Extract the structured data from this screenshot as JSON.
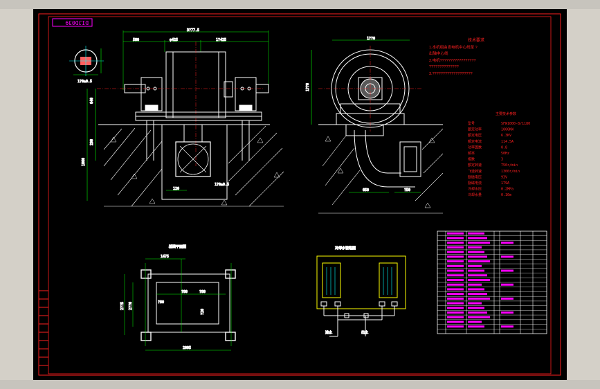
{
  "title_stamp": "DIJD039",
  "dims": {
    "top_total": "3?77.5",
    "d1": "580",
    "d2": "φ425",
    "d3": "1?425",
    "left_v1": "640",
    "left_v2": "290",
    "left_v3": "1860",
    "gap": "120",
    "small1": "1?0±0.5",
    "side_w": "1??0",
    "side_h": "1??0",
    "side_b1": "650",
    "side_b2": "?50",
    "plan_w": "1475",
    "plan_total": "2095",
    "plan_h1": "2??5",
    "plan_h2": "2??0",
    "plan_a": "?80",
    "plan_b": "?80",
    "plan_c": "?80",
    "plan_d": "?20"
  },
  "tech_req": {
    "heading": "技术要求",
    "lines": [
      "1.本机组由发电机中心线至 ?",
      "  出轴中心线",
      "2.电机?????????????????",
      "  ??????????????",
      "3.???????????????????"
    ]
  },
  "spec": {
    "heading": "主要技术参数",
    "rows": [
      {
        "k": "型号",
        "v": "SFW1000-8/1180"
      },
      {
        "k": "额定功率",
        "v": "1000KW"
      },
      {
        "k": "额定电压",
        "v": "6.3KV"
      },
      {
        "k": "额定电流",
        "v": "114.5A"
      },
      {
        "k": "功率因数",
        "v": "0.8"
      },
      {
        "k": "频率",
        "v": "50Hz"
      },
      {
        "k": "相数",
        "v": "3"
      },
      {
        "k": "额定转速",
        "v": "750r/min"
      },
      {
        "k": "飞逸转速",
        "v": "1300r/min"
      },
      {
        "k": "励磁电压",
        "v": "93V"
      },
      {
        "k": "励磁电流",
        "v": "179A"
      },
      {
        "k": "冷却水压",
        "v": "0.2MPa"
      },
      {
        "k": "冷却水量",
        "v": "0.16m"
      }
    ]
  },
  "labels": {
    "plan_title": "基础平面图",
    "pipe_title": "冷却水管路图",
    "pipe_in": "进水",
    "pipe_out": "出水"
  },
  "bom_rows": 22,
  "colors": {
    "bg": "#000000",
    "line": "#ffffff",
    "dim": "#00ff00",
    "red": "#ff2020",
    "yellow": "#ffff00",
    "magenta": "#ff00ff",
    "cyan": "#00ffff"
  }
}
